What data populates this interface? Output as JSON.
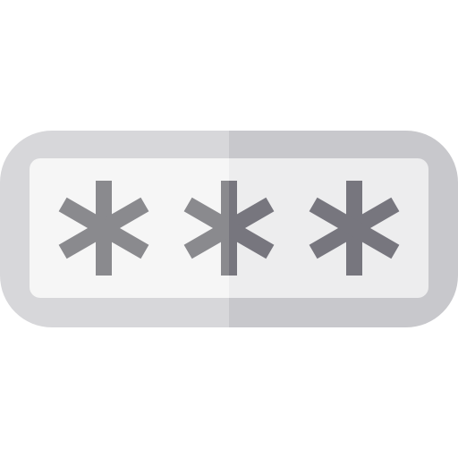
{
  "icon": {
    "name": "password-field-icon",
    "masked_characters": 3,
    "glyph": "asterisk-icon"
  },
  "colors": {
    "outer_left": "#D7D7DA",
    "outer_right": "#C8C8CC",
    "inner_left": "#F6F6F6",
    "inner_right": "#EDEDEE",
    "asterisk_left": "#8A8A8E",
    "asterisk_right": "#77767E"
  }
}
